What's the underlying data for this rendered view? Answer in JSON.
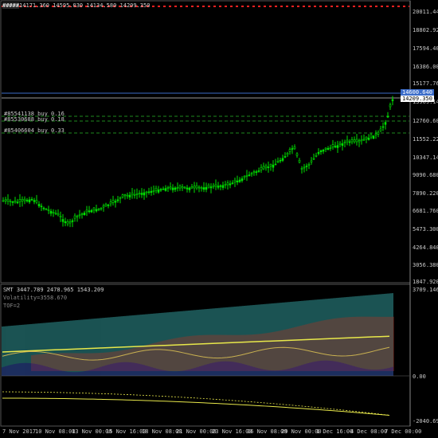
{
  "main_chart": {
    "ohlc_header": "14171.360 14595.030 14134.580 14209.350",
    "price_badge_blue": "14600.640",
    "price_badge_white": "14209.350",
    "price_axis": [
      "20011.440",
      "18802.920",
      "17594.400",
      "16386.000",
      "15177.760",
      "13969.140",
      "12760.600",
      "11552.220",
      "10347.140",
      "9090.680",
      "7890.220",
      "6681.760",
      "5473.300",
      "4264.840",
      "3056.380",
      "1847.920"
    ],
    "orders": [
      {
        "label": "#85541138 buy 0.16"
      },
      {
        "label": "#85530688 buy 0.18"
      },
      {
        "label": "#85406604 buy 0.33"
      }
    ],
    "colors": {
      "candle": "#00e000",
      "grid": "#2a2a2a",
      "order_line": "#1e8a1e",
      "top_dashes": "#ff2020",
      "badge_blue": "#3b6cc9"
    }
  },
  "indicator": {
    "header": "SMT 3447.789 2478.965 1543.209",
    "volatility": "Volatility=3558.670",
    "tof": "TOF=2",
    "axis_top": "3709.146",
    "axis_zero": "0.00",
    "axis_bottom": "-2040.691"
  },
  "time_axis": [
    "7 Nov 2017",
    "10 Nov 08:00",
    "13 Nov 00:00",
    "15 Nov 16:00",
    "18 Nov 08:00",
    "21 Nov 00:00",
    "23 Nov 16:00",
    "26 Nov 08:00",
    "29 Nov 00:00",
    "1 Dec 16:00",
    "4 Dec 08:00",
    "7 Dec 00:00"
  ]
}
